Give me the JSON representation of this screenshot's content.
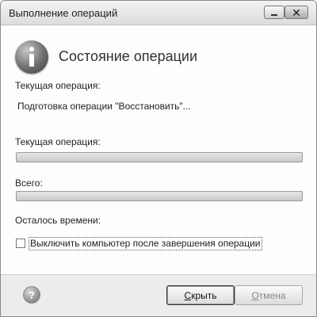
{
  "window": {
    "title": "Выполнение операций",
    "close_glyph": "✕"
  },
  "header": {
    "icon": "info-icon",
    "title": "Состояние операции"
  },
  "status": {
    "current_operation_label": "Текущая операция:",
    "current_operation_value": "Подготовка операции \"Восстановить\"...",
    "current_progress_label": "Текущая операция:",
    "current_progress_percent": 0,
    "total_label": "Всего:",
    "total_progress_percent": 0,
    "time_remaining_label": "Осталось времени:"
  },
  "options": {
    "shutdown_label": "Выключить компьютер после завершения операции",
    "shutdown_checked": false
  },
  "footer": {
    "help_icon": "help-icon",
    "help_glyph": "?",
    "hide_button": {
      "access": "С",
      "rest": "крыть"
    },
    "cancel_button": {
      "access": "О",
      "rest": "тмена"
    }
  }
}
